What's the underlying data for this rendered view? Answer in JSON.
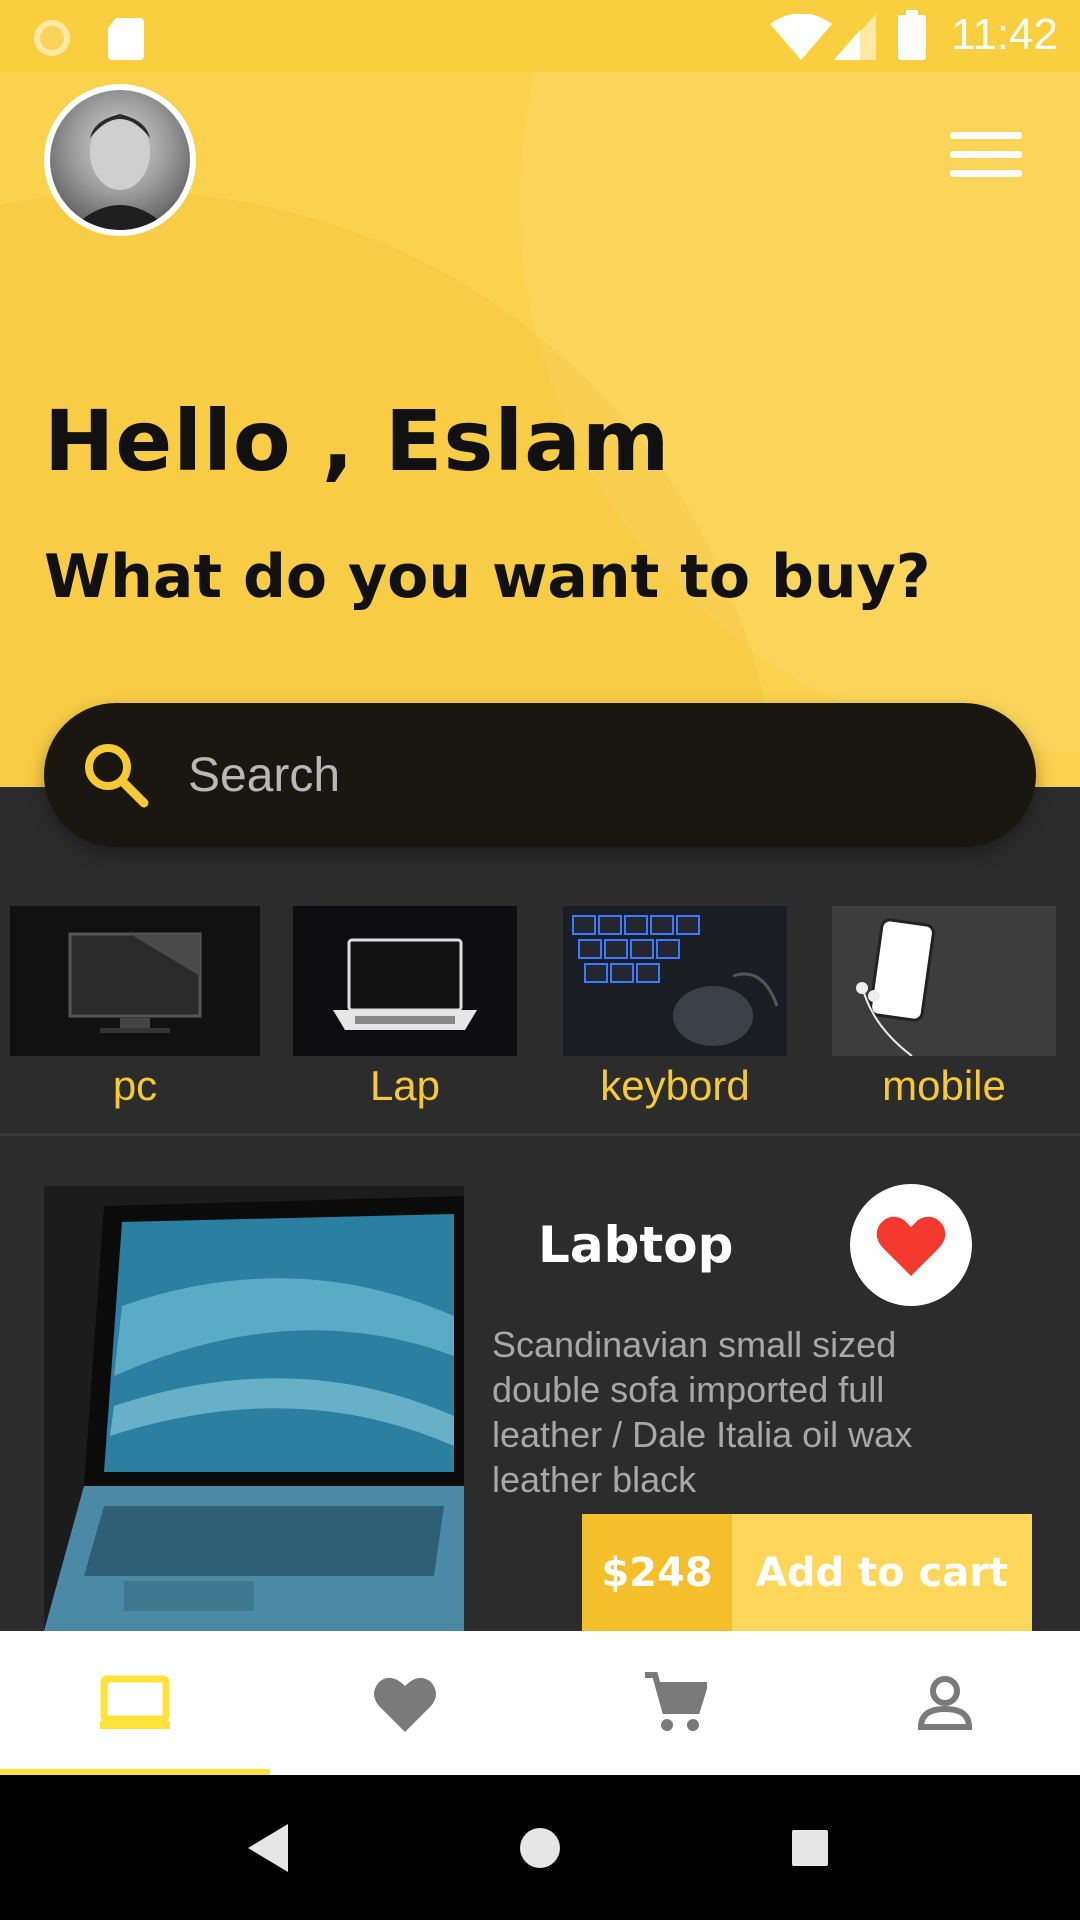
{
  "status_bar": {
    "time": "11:42",
    "icons": [
      "sun-notification-icon",
      "sd-card-icon",
      "wifi-icon",
      "signal-icon",
      "battery-icon"
    ]
  },
  "header": {
    "avatar_alt": "profile photo",
    "greeting": "Hello , Eslam",
    "question": "What do you want to buy?",
    "colors": {
      "background": "#fbd24e",
      "text": "#111111"
    }
  },
  "search": {
    "placeholder": "Search",
    "value": ""
  },
  "categories": [
    {
      "label": "pc",
      "icon": "pc-monitor-image"
    },
    {
      "label": "Lap",
      "icon": "laptop-image"
    },
    {
      "label": "keybord",
      "icon": "keyboard-mouse-image"
    },
    {
      "label": "mobile",
      "icon": "mobile-phone-image"
    }
  ],
  "product": {
    "title": "Labtop",
    "description": "Scandinavian small sized double sofa imported full leather / Dale Italia oil wax leather black",
    "price": "$248",
    "add_to_cart": "Add to cart",
    "favorite": true
  },
  "bottom_nav": {
    "items": [
      {
        "name": "home",
        "icon": "laptop-icon",
        "active": true
      },
      {
        "name": "favorites",
        "icon": "heart-icon",
        "active": false
      },
      {
        "name": "cart",
        "icon": "cart-icon",
        "active": false
      },
      {
        "name": "profile",
        "icon": "person-icon",
        "active": false
      }
    ],
    "active_color": "#ffe23a"
  },
  "system_nav": [
    "back",
    "home",
    "recents"
  ],
  "colors": {
    "accent": "#f7c934",
    "dark_bg": "#2c2c2c",
    "price_bg": "#f5be2b",
    "cart_bg": "#fdd65a"
  }
}
